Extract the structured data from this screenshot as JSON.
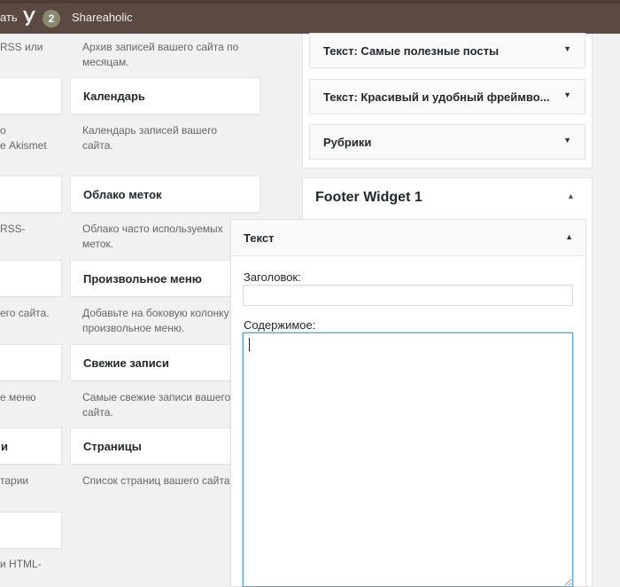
{
  "adminbar": {
    "truncated_item": "ать",
    "notification_count": "2",
    "shareaholic_label": "Shareaholic"
  },
  "available_widgets": {
    "left_column": [
      {
        "title": "",
        "desc_lines": [
          "RSS или",
          ""
        ]
      },
      {
        "title": "",
        "desc_lines": [
          "о",
          "е Akismet"
        ]
      },
      {
        "title": "",
        "desc_lines": [
          "RSS-",
          ""
        ]
      },
      {
        "title": "",
        "desc_lines": [
          "его сайта.",
          ""
        ]
      },
      {
        "title": "",
        "desc_lines": [
          "е меню",
          ""
        ]
      },
      {
        "title": "и",
        "desc_lines": [
          "тарии",
          ""
        ]
      },
      {
        "title": "",
        "desc_lines": [
          "и HTML-",
          ""
        ]
      }
    ],
    "right_column": [
      {
        "title": "",
        "desc_lines": [
          "Архив записей вашего сайта по",
          "месяцам."
        ]
      },
      {
        "title": "Календарь",
        "desc_lines": [
          "Календарь записей вашего",
          "сайта."
        ]
      },
      {
        "title": "Облако меток",
        "desc_lines": [
          "Облако часто используемых",
          "меток."
        ]
      },
      {
        "title": "Произвольное меню",
        "desc_lines": [
          "Добавьте на боковую колонку",
          "произвольное меню."
        ]
      },
      {
        "title": "Свежие записи",
        "desc_lines": [
          "Самые свежие записи вашего",
          "сайта."
        ]
      },
      {
        "title": "Страницы",
        "desc_lines": [
          "Список страниц вашего сайта.",
          ""
        ]
      }
    ]
  },
  "sidebar_widgets": [
    {
      "label": "Текст: ",
      "detail": "Самые полезные посты"
    },
    {
      "label": "Текст: ",
      "detail": "Красивый и удобный фреймво..."
    },
    {
      "label": "Рубрики",
      "detail": ""
    }
  ],
  "footer_area": {
    "title": "Footer Widget 1",
    "text_widget": {
      "title": "Текст",
      "heading_label": "Заголовок:",
      "heading_value": "",
      "content_label": "Содержимое:",
      "content_value": ""
    }
  },
  "colors": {
    "adminbar_bg": "#5a4a42",
    "badge_bg": "#898970",
    "focus_border": "#5b9dd9",
    "page_bg": "#f1f1f1"
  },
  "icons": {
    "yoast": "yoast-logo-icon",
    "expand": "triangle-down-icon",
    "collapse": "triangle-up-icon",
    "resize": "resize-grip-icon"
  }
}
